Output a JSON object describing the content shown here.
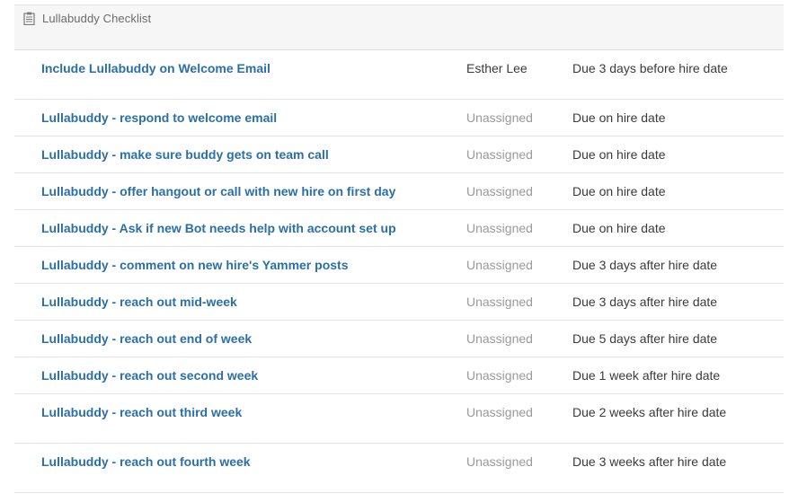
{
  "checklist": {
    "title": "Lullabuddy Checklist",
    "icon": "clipboard-icon"
  },
  "tasks": [
    {
      "name": "Include Lullabuddy on Welcome Email",
      "assignee": "Esther Lee",
      "assigned": true,
      "due": "Due 3 days before hire date"
    },
    {
      "name": "Lullabuddy - respond to welcome email",
      "assignee": "Unassigned",
      "assigned": false,
      "due": "Due on hire date"
    },
    {
      "name": "Lullabuddy - make sure buddy gets on team call",
      "assignee": "Unassigned",
      "assigned": false,
      "due": "Due on hire date"
    },
    {
      "name": "Lullabuddy - offer hangout or call with new hire on first day",
      "assignee": "Unassigned",
      "assigned": false,
      "due": "Due on hire date"
    },
    {
      "name": "Lullabuddy - Ask if new Bot needs help with account set up",
      "assignee": "Unassigned",
      "assigned": false,
      "due": "Due on hire date"
    },
    {
      "name": "Lullabuddy - comment on new hire's Yammer posts",
      "assignee": "Unassigned",
      "assigned": false,
      "due": "Due 3 days after hire date"
    },
    {
      "name": "Lullabuddy - reach out mid-week",
      "assignee": "Unassigned",
      "assigned": false,
      "due": "Due 3 days after hire date"
    },
    {
      "name": "Lullabuddy - reach out end of week",
      "assignee": "Unassigned",
      "assigned": false,
      "due": "Due 5 days after hire date"
    },
    {
      "name": "Lullabuddy - reach out second week",
      "assignee": "Unassigned",
      "assigned": false,
      "due": "Due 1 week after hire date"
    },
    {
      "name": "Lullabuddy - reach out third week",
      "assignee": "Unassigned",
      "assigned": false,
      "due": "Due 2 weeks after hire date"
    },
    {
      "name": "Lullabuddy - reach out fourth week",
      "assignee": "Unassigned",
      "assigned": false,
      "due": "Due 3 weeks after hire date"
    }
  ],
  "colors": {
    "link": "#2a6fa8",
    "assigned_text": "#3a3a3a",
    "unassigned_text": "#9a9a9a",
    "header_bg": "#f6f6f6"
  }
}
